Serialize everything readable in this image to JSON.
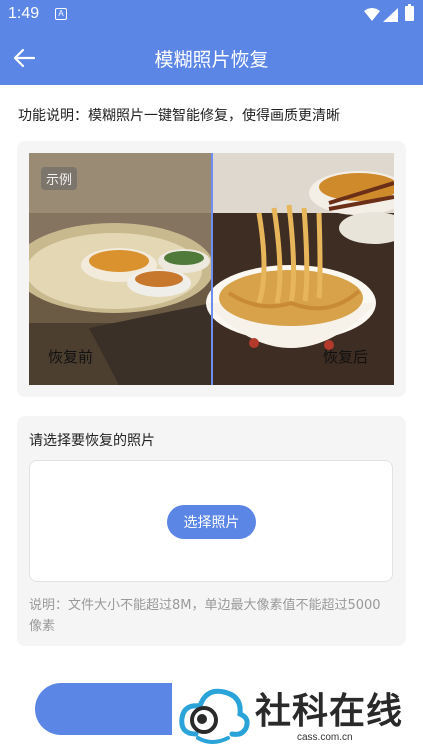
{
  "status_bar": {
    "time": "1:49",
    "notification_icon": "A",
    "icons": [
      "wifi-icon",
      "signal-icon",
      "battery-icon"
    ]
  },
  "app_bar": {
    "title": "模糊照片恢复",
    "back_icon": "arrow-left-icon",
    "color": "#5b86e5"
  },
  "description": "功能说明：模糊照片一键智能修复，使得画质更清晰",
  "example": {
    "tag": "示例",
    "before_label": "恢复前",
    "after_label": "恢复后"
  },
  "select": {
    "title": "请选择要恢复的照片",
    "button_label": "选择照片",
    "note": "说明：文件大小不能超过8M，单边最大像素值不能超过5000像素"
  },
  "watermark": {
    "text": "社科在线",
    "url": "cass.com.cn"
  },
  "colors": {
    "accent": "#5b86e5",
    "card_bg": "#f5f5f5",
    "note_text": "#999999"
  }
}
